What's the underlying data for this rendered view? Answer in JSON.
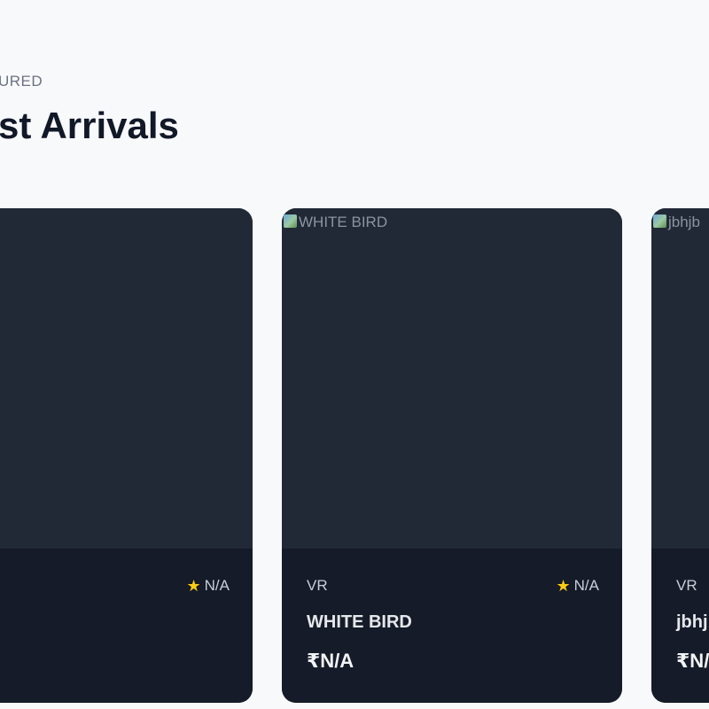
{
  "section": {
    "eyebrow": "URED",
    "title": "st Arrivals"
  },
  "cards": [
    {
      "image_alt": "",
      "category": "",
      "rating": "N/A",
      "name": "",
      "price": ""
    },
    {
      "image_alt": "WHITE BIRD",
      "category": "VR",
      "rating": "N/A",
      "name": "WHITE BIRD",
      "price": "₹N/A"
    },
    {
      "image_alt": "jbhjb",
      "category": "VR",
      "rating": "",
      "name": "jbhj",
      "price": "₹N/"
    }
  ],
  "icons": {
    "rating": "star-icon",
    "broken_image": "broken-image-icon"
  },
  "colors": {
    "page_bg": "#f8f9fb",
    "card_bg": "#212936",
    "card_info_bg": "#151b28",
    "star": "#facc15"
  }
}
